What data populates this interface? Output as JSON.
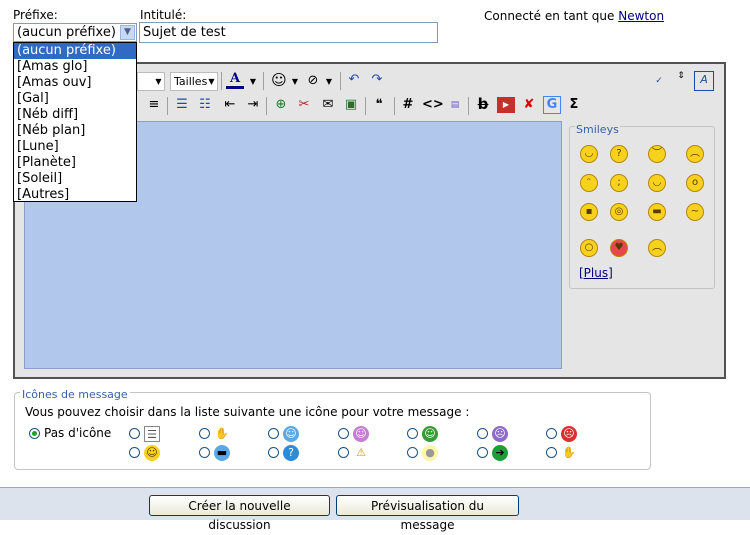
{
  "header": {
    "prefix_label": "Préfixe:",
    "title_label": "Intitulé:",
    "connected_text": "Connecté en tant que",
    "username": "Newton"
  },
  "prefix": {
    "selected": "(aucun préfixe)",
    "options": [
      "(aucun préfixe)",
      "[Amas glo]",
      "[Amas ouv]",
      "[Gal]",
      "[Néb diff]",
      "[Néb plan]",
      "[Lune]",
      "[Planète]",
      "[Soleil]",
      "[Autres]"
    ]
  },
  "title_input": {
    "value": "Sujet de test"
  },
  "toolbar": {
    "font_sizes_label": "Tailles",
    "font_color_glyph": "A",
    "hash_glyph": "#",
    "code_glyph": "<>",
    "sigma_glyph": "Σ",
    "strike_glyph": "b",
    "google_glyph": "G",
    "x_glyph": "✘"
  },
  "smileys": {
    "legend": "Smileys",
    "more": "[Plus]",
    "items": [
      "smile",
      "confused",
      "angry",
      "frown",
      "tongue",
      "wink",
      "biggrin",
      "surprised",
      "cool",
      "glasses",
      "grin",
      "dizzy",
      "eek",
      "love",
      "sad"
    ]
  },
  "message_icons": {
    "legend": "Icônes de message",
    "description": "Vous pouvez choisir dans la liste suivante une icône pour votre message :",
    "none_label": "Pas d'icône",
    "icons": [
      "document-icon",
      "thumbs-down-icon",
      "smile-icon",
      "tongue-icon",
      "grin-icon",
      "sad-purple-icon",
      "angry-icon",
      "smile-yellow-icon",
      "sunglasses-icon",
      "question-icon",
      "warning-icon",
      "lightbulb-icon",
      "arrow-right-icon",
      "thumbs-up-icon"
    ]
  },
  "footer": {
    "create_button": "Créer la nouvelle discussion",
    "preview_button": "Prévisualisation du message"
  },
  "colors": {
    "accent": "#316ac5",
    "textarea": "#b2c7ec",
    "frame": "#e5e5e5"
  }
}
